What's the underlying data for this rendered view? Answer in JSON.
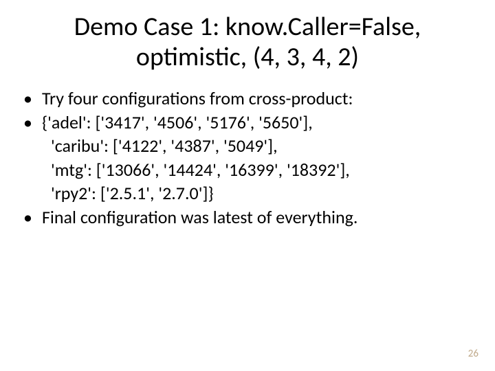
{
  "title_line1": "Demo Case 1: know.Caller=False,",
  "title_line2": "optimistic, (4, 3, 4, 2)",
  "bullets": {
    "b1": "Try four configurations from cross-product:",
    "b2": "{'adel': ['3417', '4506', '5176', '5650'],",
    "b2_cont1": "'caribu': ['4122', '4387', '5049'],",
    "b2_cont2": " 'mtg': ['13066', '14424', '16399', '18392'],",
    "b2_cont3": "'rpy2': ['2.5.1', '2.7.0']}",
    "b3": "Final configuration was latest of everything."
  },
  "page_number": "26"
}
